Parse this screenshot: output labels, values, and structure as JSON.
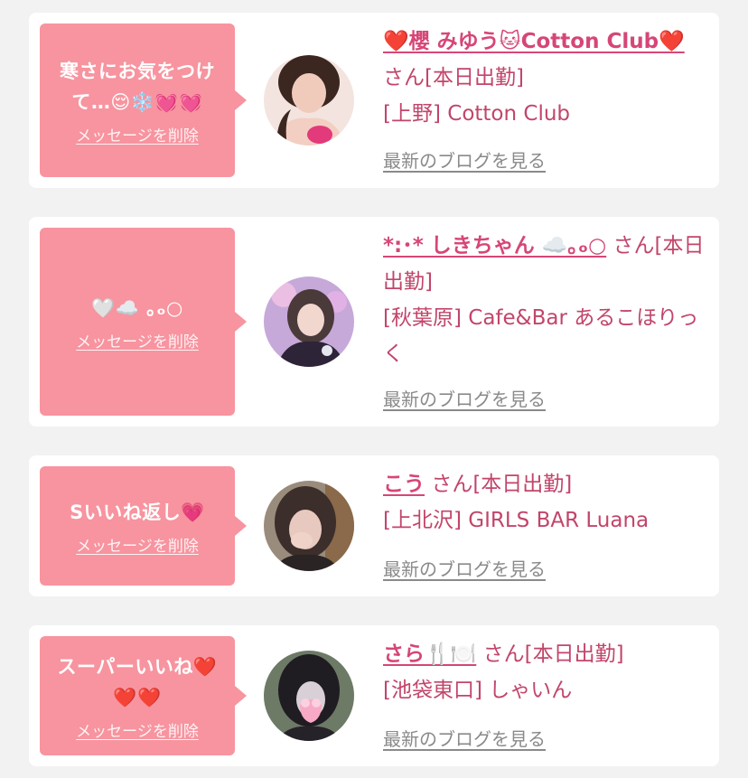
{
  "delete_label": "メッセージを削除",
  "blog_label": "最新のブログを見る",
  "san_suffix": "さん[本日出勤]",
  "cards": [
    {
      "message": "寒さにお気をつけて…😌❄️💓💓",
      "name": "❤️櫻 みゆう🐱Cotton Club❤️",
      "place": "[上野] Cotton Club"
    },
    {
      "message": "🤍☁️ ｡ₒ○",
      "name": "*:･* しきちゃん ☁️｡ₒ○",
      "place": "[秋葉原] Cafe&Bar あるこほりっく"
    },
    {
      "message": "Sいいね返し💗",
      "name": "こう",
      "place": "[上北沢] GIRLS BAR Luana"
    },
    {
      "message": "スーパーいいね❤️❤️❤️",
      "name": "さら🍴🍽️",
      "place": "[池袋東口] しゃいん"
    }
  ],
  "colors": {
    "background": "#f2f2f2",
    "bubble": "#f7949f",
    "name": "#d64677",
    "text": "#c2456a",
    "link_gray": "#8a8a8a"
  }
}
